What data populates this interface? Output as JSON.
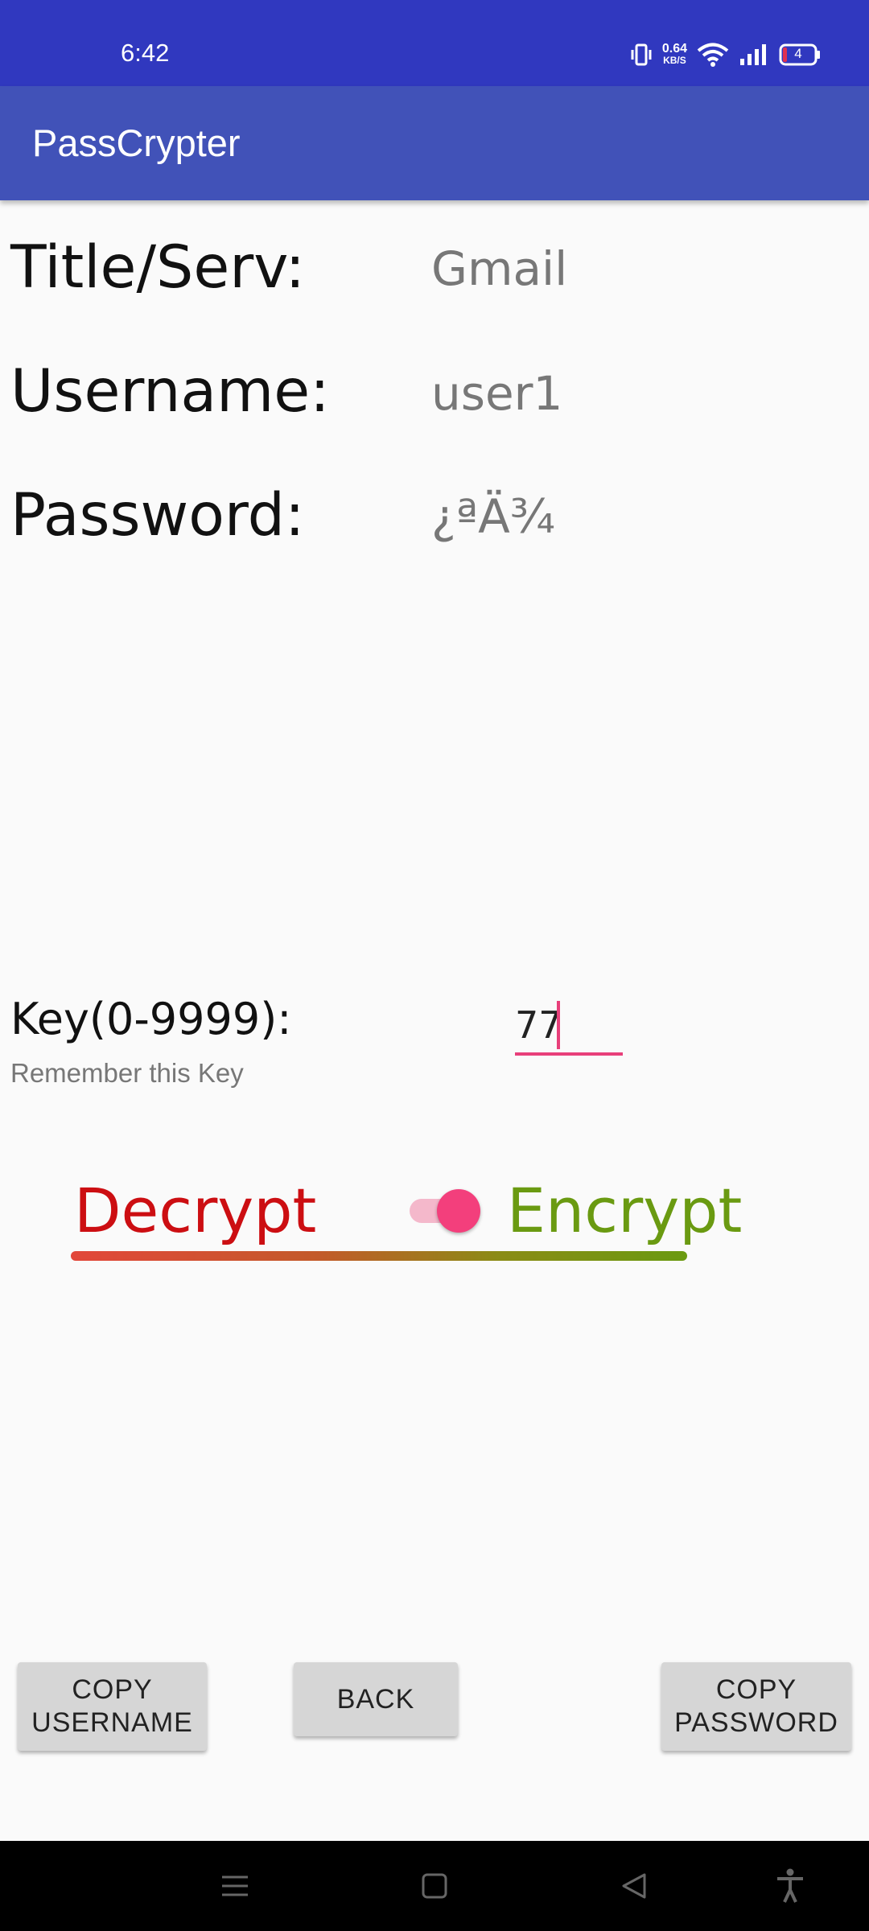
{
  "status_bar": {
    "time": "6:42",
    "net_speed_value": "0.64",
    "net_speed_unit": "KB/S",
    "battery_level": "4"
  },
  "app_bar": {
    "title": "PassCrypter"
  },
  "fields": {
    "title": {
      "label": "Title/Serv:",
      "value": "Gmail"
    },
    "username": {
      "label": "Username:",
      "value": "user1"
    },
    "password": {
      "label": "Password:",
      "value": "¿ªÄ¾"
    }
  },
  "key": {
    "label": "Key(0-9999):",
    "hint": "Remember this Key",
    "value": "77"
  },
  "mode": {
    "decrypt_label": "Decrypt",
    "encrypt_label": "Encrypt",
    "toggle_on": true
  },
  "buttons": {
    "copy_username": [
      "COPY",
      "USERNAME"
    ],
    "back": "BACK",
    "copy_password": [
      "COPY",
      "PASSWORD"
    ]
  },
  "colors": {
    "status_bar": "#3038bf",
    "app_bar": "#4152b8",
    "accent": "#f33f7c",
    "decrypt": "#cc0e12",
    "encrypt": "#6a9a11"
  },
  "nav_bar": {
    "icons": [
      "menu-icon",
      "home-icon",
      "back-icon",
      "accessibility-icon"
    ]
  }
}
